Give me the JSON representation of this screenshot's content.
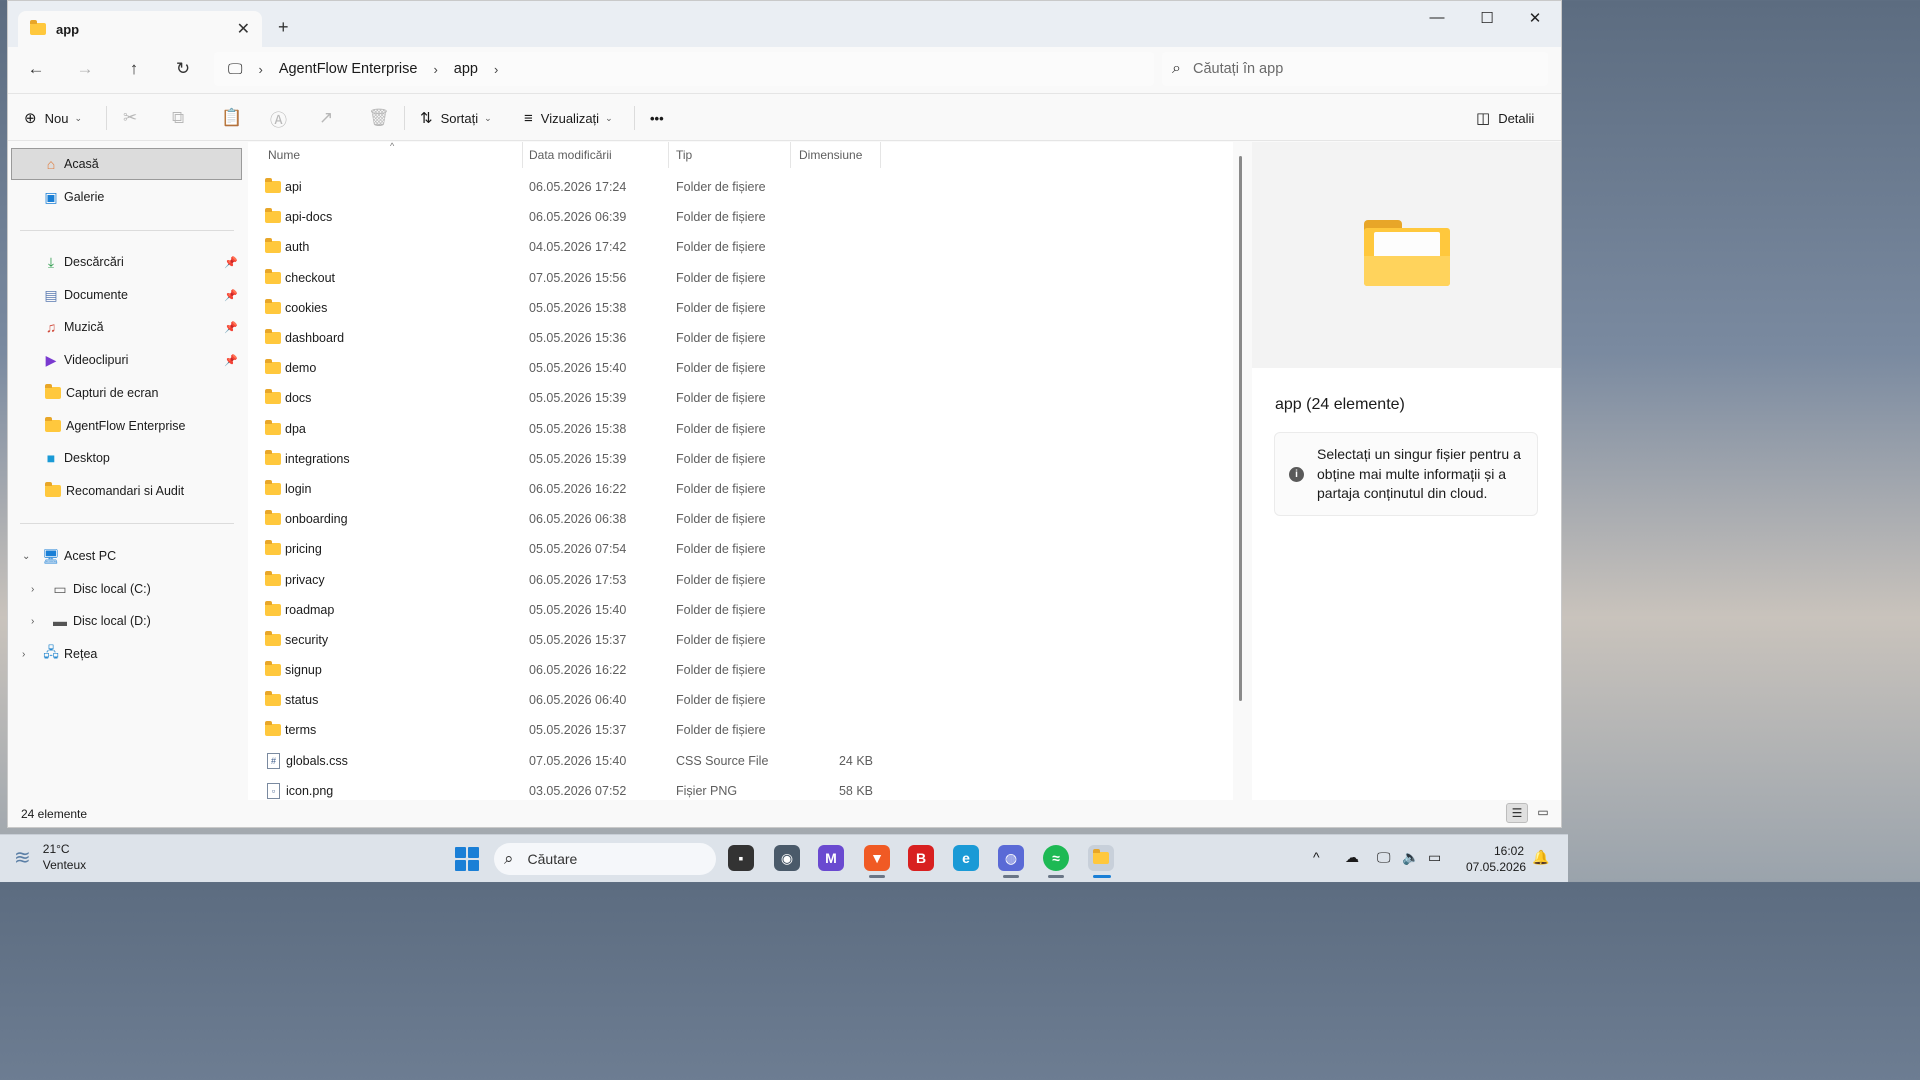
{
  "window": {
    "tab_title": "app",
    "new_tab": "+",
    "controls": {
      "minimize": "—",
      "maximize": "☐",
      "close": "✕"
    }
  },
  "nav": {
    "breadcrumb": [
      "AgentFlow Enterprise",
      "app"
    ],
    "search_placeholder": "Căutați în app"
  },
  "commands": {
    "new_label": "Nou",
    "sort_label": "Sortați",
    "view_label": "Vizualizați",
    "more_label": "•••",
    "details_label": "Detalii"
  },
  "sidebar": {
    "top": [
      {
        "label": "Acasă"
      },
      {
        "label": "Galerie"
      }
    ],
    "quick": [
      {
        "label": "Descărcări",
        "pinned": true
      },
      {
        "label": "Documente",
        "pinned": true
      },
      {
        "label": "Muzică",
        "pinned": true
      },
      {
        "label": "Videoclipuri",
        "pinned": true
      },
      {
        "label": "Capturi de ecran",
        "pinned": false
      },
      {
        "label": "AgentFlow Enterprise",
        "pinned": false
      },
      {
        "label": "Desktop",
        "pinned": false
      },
      {
        "label": "Recomandari si Audit",
        "pinned": false
      }
    ],
    "pc": {
      "label": "Acest PC"
    },
    "drives": [
      {
        "label": "Disc local (C:)"
      },
      {
        "label": "Disc local (D:)"
      }
    ],
    "network": {
      "label": "Rețea"
    }
  },
  "list": {
    "headers": {
      "name": "Nume",
      "date": "Data modificării",
      "type": "Tip",
      "size": "Dimensiune"
    },
    "files": [
      {
        "name": "api",
        "date": "06.05.2026 17:24",
        "type": "Folder de fișiere",
        "size": "",
        "kind": "folder"
      },
      {
        "name": "api-docs",
        "date": "06.05.2026 06:39",
        "type": "Folder de fișiere",
        "size": "",
        "kind": "folder"
      },
      {
        "name": "auth",
        "date": "04.05.2026 17:42",
        "type": "Folder de fișiere",
        "size": "",
        "kind": "folder"
      },
      {
        "name": "checkout",
        "date": "07.05.2026 15:56",
        "type": "Folder de fișiere",
        "size": "",
        "kind": "folder"
      },
      {
        "name": "cookies",
        "date": "05.05.2026 15:38",
        "type": "Folder de fișiere",
        "size": "",
        "kind": "folder"
      },
      {
        "name": "dashboard",
        "date": "05.05.2026 15:36",
        "type": "Folder de fișiere",
        "size": "",
        "kind": "folder"
      },
      {
        "name": "demo",
        "date": "05.05.2026 15:40",
        "type": "Folder de fișiere",
        "size": "",
        "kind": "folder"
      },
      {
        "name": "docs",
        "date": "05.05.2026 15:39",
        "type": "Folder de fișiere",
        "size": "",
        "kind": "folder"
      },
      {
        "name": "dpa",
        "date": "05.05.2026 15:38",
        "type": "Folder de fișiere",
        "size": "",
        "kind": "folder"
      },
      {
        "name": "integrations",
        "date": "05.05.2026 15:39",
        "type": "Folder de fișiere",
        "size": "",
        "kind": "folder"
      },
      {
        "name": "login",
        "date": "06.05.2026 16:22",
        "type": "Folder de fișiere",
        "size": "",
        "kind": "folder"
      },
      {
        "name": "onboarding",
        "date": "06.05.2026 06:38",
        "type": "Folder de fișiere",
        "size": "",
        "kind": "folder"
      },
      {
        "name": "pricing",
        "date": "05.05.2026 07:54",
        "type": "Folder de fișiere",
        "size": "",
        "kind": "folder"
      },
      {
        "name": "privacy",
        "date": "06.05.2026 17:53",
        "type": "Folder de fișiere",
        "size": "",
        "kind": "folder"
      },
      {
        "name": "roadmap",
        "date": "05.05.2026 15:40",
        "type": "Folder de fișiere",
        "size": "",
        "kind": "folder"
      },
      {
        "name": "security",
        "date": "05.05.2026 15:37",
        "type": "Folder de fișiere",
        "size": "",
        "kind": "folder"
      },
      {
        "name": "signup",
        "date": "06.05.2026 16:22",
        "type": "Folder de fișiere",
        "size": "",
        "kind": "folder"
      },
      {
        "name": "status",
        "date": "06.05.2026 06:40",
        "type": "Folder de fișiere",
        "size": "",
        "kind": "folder"
      },
      {
        "name": "terms",
        "date": "05.05.2026 15:37",
        "type": "Folder de fișiere",
        "size": "",
        "kind": "folder"
      },
      {
        "name": "globals.css",
        "date": "07.05.2026 15:40",
        "type": "CSS Source File",
        "size": "24 KB",
        "kind": "css"
      },
      {
        "name": "icon.png",
        "date": "03.05.2026 07:52",
        "type": "Fișier PNG",
        "size": "58 KB",
        "kind": "png"
      }
    ]
  },
  "details": {
    "title": "app (24 elemente)",
    "info": "Selectați un singur fișier pentru a obține mai multe informații și a partaja conținutul din cloud."
  },
  "status": {
    "count": "24 elemente"
  },
  "taskbar": {
    "weather_temp": "21°C",
    "weather_desc": "Venteux",
    "search_label": "Căutare",
    "time": "16:02",
    "date": "07.05.2026"
  },
  "colors": {
    "accent": "#1a7fd6",
    "folder": "#ffc83d",
    "selected": "#dcdcdc"
  }
}
